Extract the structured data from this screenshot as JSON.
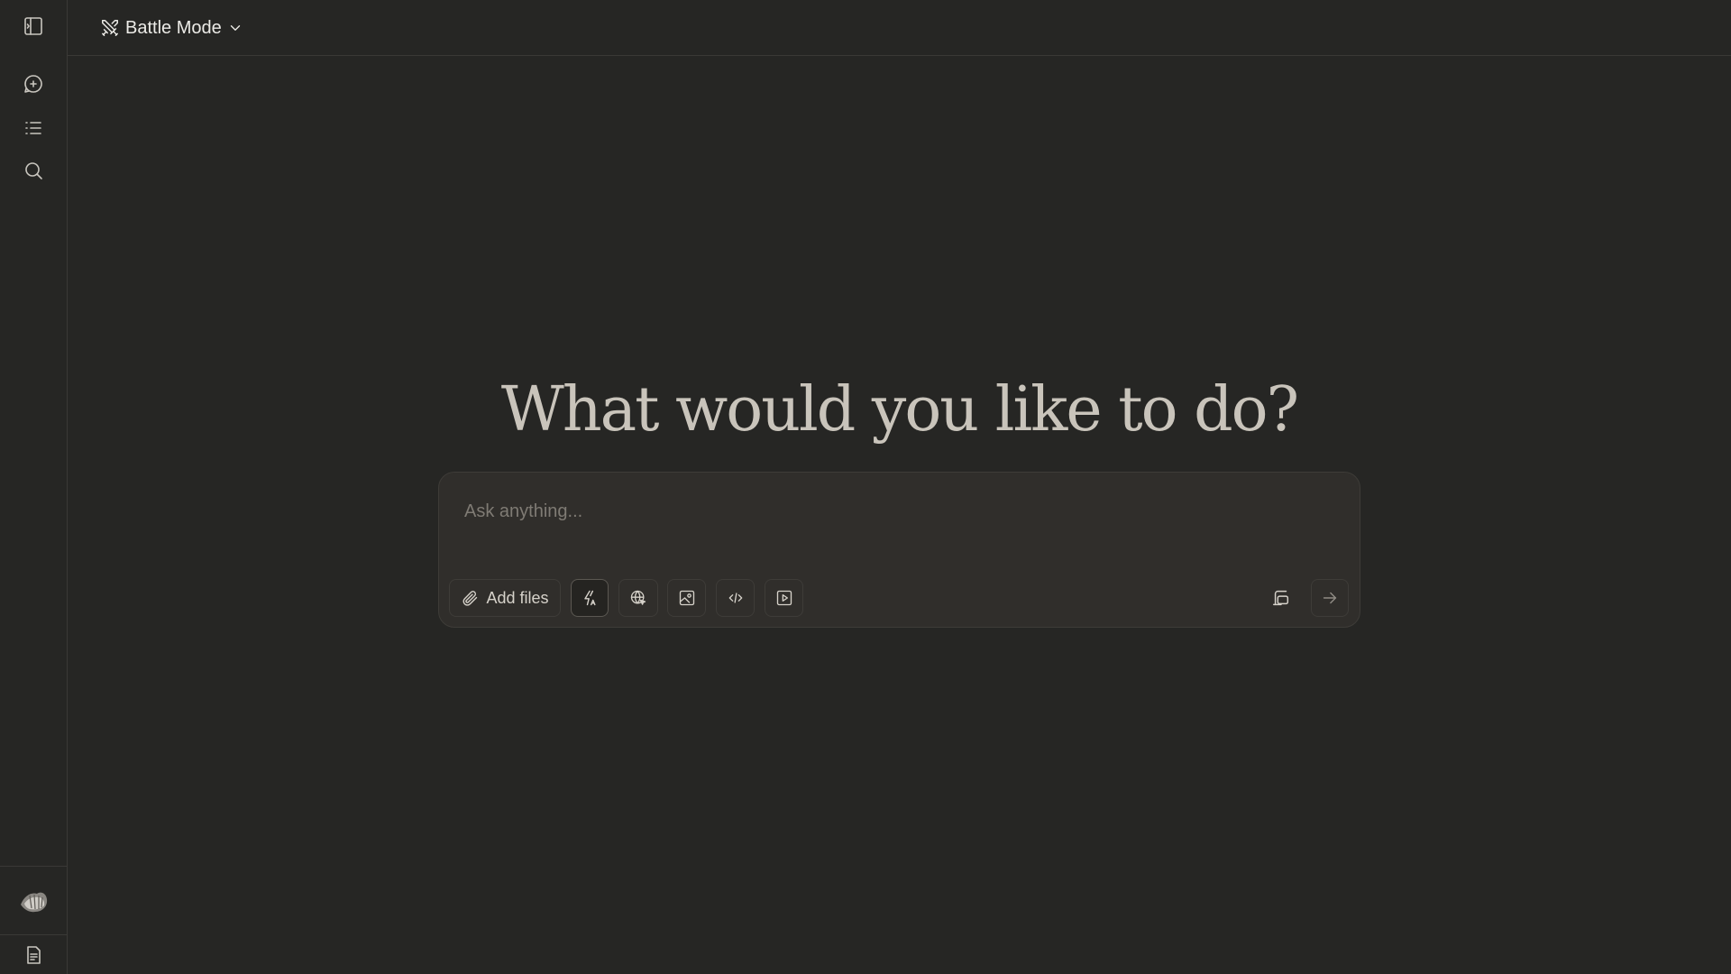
{
  "sidebar": {
    "icons": [
      "sidebar-toggle-icon",
      "new-chat-icon",
      "list-icon",
      "search-icon"
    ],
    "footer_icons": [
      "avatar",
      "document-icon"
    ]
  },
  "topbar": {
    "mode_label": "Battle Mode",
    "mode_icon": "crossed-swords-icon"
  },
  "main": {
    "headline": "What would you like to do?",
    "input_placeholder": "Ask anything...",
    "add_files_label": "Add files",
    "tools": [
      "lightning-icon",
      "globe-icon",
      "image-icon",
      "code-icon",
      "video-icon"
    ]
  },
  "colors": {
    "background": "#262624",
    "composer": "#302e2b",
    "border": "#3e3c38",
    "text": "#e6e3dc",
    "headline": "#c9c4bb"
  }
}
